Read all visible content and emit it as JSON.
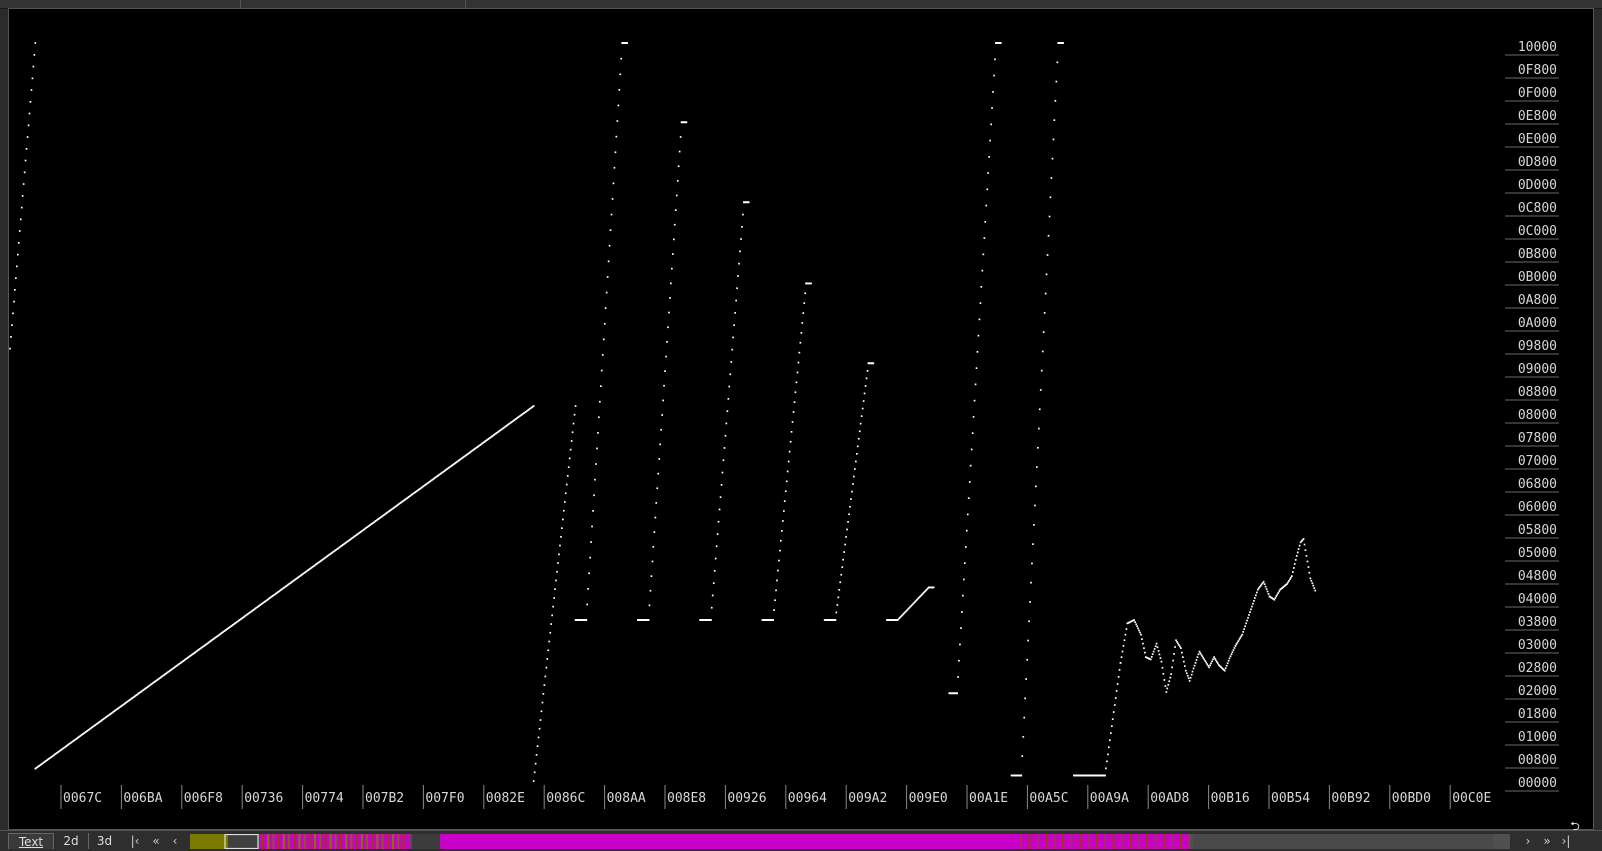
{
  "view_tabs": [
    {
      "label": "Text",
      "active": true
    },
    {
      "label": "2d",
      "active": false
    },
    {
      "label": "3d",
      "active": false
    }
  ],
  "nav": {
    "first_icon": "skip-first-icon",
    "prev_fast_icon": "double-chevron-left-icon",
    "prev_icon": "chevron-left-icon",
    "next_icon": "chevron-right-icon",
    "next_fast_icon": "double-chevron-right-icon",
    "last_icon": "skip-last-icon"
  },
  "colors": {
    "background": "#000000",
    "plot_points": "#ffffff",
    "axis_text": "#d8d8d8",
    "minimap_magenta": "#c800c8",
    "minimap_olive": "#7a7a00",
    "minimap_rust": "#9a3a10",
    "minimap_gray": "#505050"
  },
  "chart_data": {
    "type": "scatter",
    "x_ticks": [
      "0067C",
      "006BA",
      "006F8",
      "00736",
      "00774",
      "007B2",
      "007F0",
      "0082E",
      "0086C",
      "008AA",
      "008E8",
      "00926",
      "00964",
      "009A2",
      "009E0",
      "00A1E",
      "00A5C",
      "00A9A",
      "00AD8",
      "00B16",
      "00B54",
      "00B92",
      "00BD0",
      "00C0E"
    ],
    "y_ticks": [
      "10000",
      "0F800",
      "0F000",
      "0E800",
      "0E000",
      "0D800",
      "0D000",
      "0C800",
      "0C000",
      "0B800",
      "0B000",
      "0A800",
      "0A000",
      "09800",
      "09000",
      "08800",
      "08000",
      "07800",
      "07000",
      "06800",
      "06000",
      "05800",
      "05000",
      "04800",
      "04000",
      "03800",
      "03000",
      "02800",
      "02000",
      "01800",
      "01000",
      "00800",
      "00000"
    ],
    "ylim": [
      0,
      65536
    ],
    "xlim_hex": [
      "0064F",
      "00C4F"
    ],
    "segments": [
      {
        "kind": "line",
        "x0": "00650",
        "y0": 38400,
        "x1": "0066A",
        "y1": 65536
      },
      {
        "kind": "line",
        "x0": "0066A",
        "y0": 1100,
        "x1": "0086A",
        "y1": 33300
      },
      {
        "kind": "line",
        "x0": "0086A",
        "y0": 0,
        "x1": "00895",
        "y1": 33300
      },
      {
        "kind": "flat",
        "x0": "00895",
        "x1": "008A0",
        "y": 14300
      },
      {
        "kind": "line",
        "x0": "008A0",
        "y0": 14300,
        "x1": "008C5",
        "y1": 65536
      },
      {
        "kind": "flat",
        "x0": "008C5",
        "x1": "008CA",
        "y": 65536
      },
      {
        "kind": "flat",
        "x0": "008D5",
        "x1": "008E0",
        "y": 14300
      },
      {
        "kind": "line",
        "x0": "008E0",
        "y0": 14300,
        "x1": "00902",
        "y1": 58500
      },
      {
        "kind": "flat",
        "x0": "00902",
        "x1": "00907",
        "y": 58500
      },
      {
        "kind": "flat",
        "x0": "00915",
        "x1": "00920",
        "y": 14300
      },
      {
        "kind": "line",
        "x0": "00920",
        "y0": 14300,
        "x1": "00942",
        "y1": 51400
      },
      {
        "kind": "flat",
        "x0": "00942",
        "x1": "00947",
        "y": 51400
      },
      {
        "kind": "flat",
        "x0": "00955",
        "x1": "00960",
        "y": 14300
      },
      {
        "kind": "line",
        "x0": "00960",
        "y0": 14300,
        "x1": "00982",
        "y1": 44200
      },
      {
        "kind": "flat",
        "x0": "00982",
        "x1": "00987",
        "y": 44200
      },
      {
        "kind": "flat",
        "x0": "00995",
        "x1": "009A0",
        "y": 14300
      },
      {
        "kind": "line",
        "x0": "009A0",
        "y0": 14300,
        "x1": "009C2",
        "y1": 37100
      },
      {
        "kind": "flat",
        "x0": "009C2",
        "x1": "009C7",
        "y": 37100
      },
      {
        "kind": "flat",
        "x0": "009D5",
        "x1": "009E0",
        "y": 14300
      },
      {
        "kind": "line",
        "x0": "009E0",
        "y0": 14300,
        "x1": "00A00",
        "y1": 17200
      },
      {
        "kind": "flat",
        "x0": "00A00",
        "x1": "00A05",
        "y": 17200
      },
      {
        "kind": "flat",
        "x0": "00A15",
        "x1": "00A1D",
        "y": 7800
      },
      {
        "kind": "line",
        "x0": "00A1D",
        "y0": 7800,
        "x1": "00A45",
        "y1": 65536
      },
      {
        "kind": "flat",
        "x0": "00A45",
        "x1": "00A4A",
        "y": 65536
      },
      {
        "kind": "flat",
        "x0": "00A55",
        "x1": "00A5F",
        "y": 500
      },
      {
        "kind": "line",
        "x0": "00A5F",
        "y0": 500,
        "x1": "00A85",
        "y1": 65536
      },
      {
        "kind": "flat",
        "x0": "00A85",
        "x1": "00A8A",
        "y": 65536
      },
      {
        "kind": "flat",
        "x0": "00A95",
        "x1": "00AB5",
        "y": 500
      },
      {
        "kind": "line",
        "x0": "00AB5",
        "y0": 500,
        "x1": "00AC5",
        "y1": 10500
      }
    ],
    "tail_curve": [
      [
        "00AC5",
        10500
      ],
      [
        "00ACC",
        14000
      ],
      [
        "00AD3",
        14300
      ],
      [
        "00ADA",
        13000
      ],
      [
        "00ADF",
        11000
      ],
      [
        "00AE4",
        10800
      ],
      [
        "00AEA",
        12200
      ],
      [
        "00AEF",
        10600
      ],
      [
        "00AF4",
        7900
      ],
      [
        "00AF9",
        9500
      ],
      [
        "00AFE",
        12500
      ],
      [
        "00B03",
        11800
      ],
      [
        "00B08",
        9800
      ],
      [
        "00B0C",
        8900
      ],
      [
        "00B10",
        10000
      ],
      [
        "00B16",
        11500
      ],
      [
        "00B1B",
        10800
      ],
      [
        "00B20",
        10100
      ],
      [
        "00B25",
        11000
      ],
      [
        "00B2A",
        10300
      ],
      [
        "00B30",
        9800
      ],
      [
        "00B35",
        10900
      ],
      [
        "00B3B",
        12000
      ],
      [
        "00B42",
        13000
      ],
      [
        "00B4A",
        15000
      ],
      [
        "00B52",
        17000
      ],
      [
        "00B58",
        17700
      ],
      [
        "00B5E",
        16400
      ],
      [
        "00B63",
        16100
      ],
      [
        "00B69",
        17000
      ],
      [
        "00B70",
        17500
      ],
      [
        "00B75",
        18200
      ],
      [
        "00B7A",
        20000
      ],
      [
        "00B7E",
        21200
      ],
      [
        "00B81",
        21500
      ],
      [
        "00B84",
        20000
      ],
      [
        "00B88",
        18000
      ],
      [
        "00B8E",
        16700
      ]
    ]
  }
}
